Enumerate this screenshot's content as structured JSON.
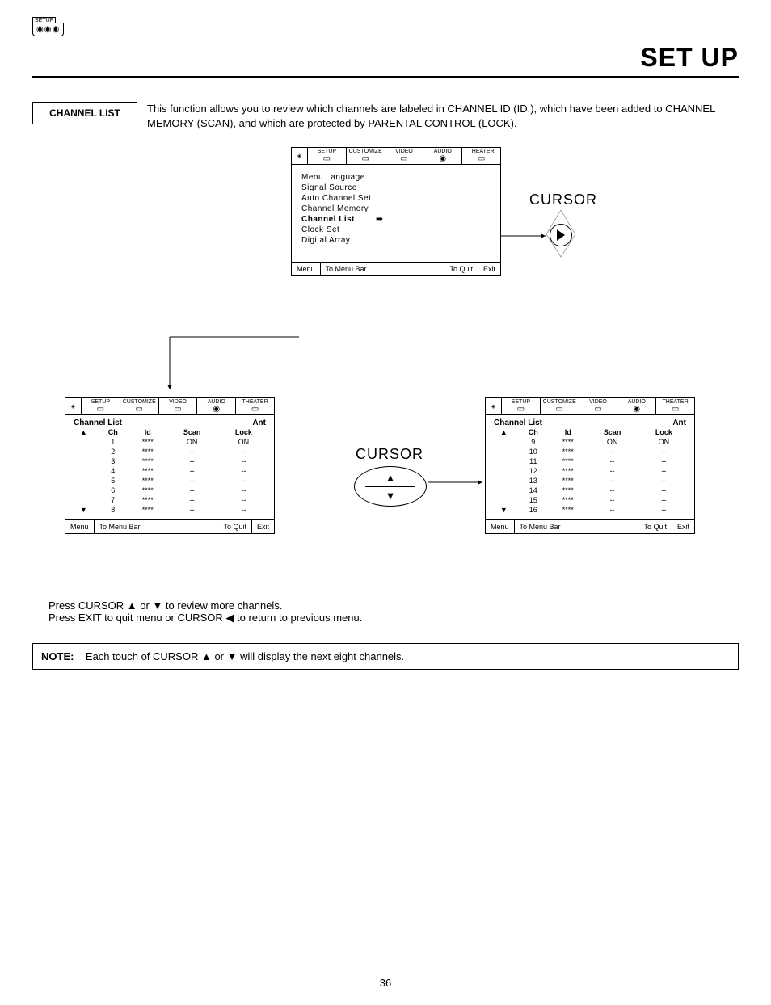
{
  "header": {
    "badge_label": "SETUP",
    "title": "SET UP"
  },
  "section": {
    "label": "CHANNEL LIST",
    "text": "This function allows you to review which channels are labeled in CHANNEL ID (ID.), which have been added to CHANNEL MEMORY (SCAN), and which are protected by PARENTAL CONTROL (LOCK)."
  },
  "osd_tabs": [
    "SETUP",
    "CUSTOMIZE",
    "VIDEO",
    "AUDIO",
    "THEATER"
  ],
  "osd_main": {
    "items": [
      "Menu Language",
      "Signal Source",
      "Auto Channel Set",
      "Channel Memory",
      "Channel List",
      "Clock Set",
      "Digital Array"
    ],
    "selected_index": 4,
    "foot_menu": "Menu",
    "foot_mid": "To Menu Bar",
    "foot_quit": "To Quit",
    "foot_exit": "Exit"
  },
  "cursor_label": "CURSOR",
  "left_list": {
    "title": "Channel List",
    "source": "Ant",
    "cols": [
      "Ch",
      "Id",
      "Scan",
      "Lock"
    ],
    "rows": [
      {
        "ch": "1",
        "id": "****",
        "scan": "ON",
        "lock": "ON"
      },
      {
        "ch": "2",
        "id": "****",
        "scan": "--",
        "lock": "--"
      },
      {
        "ch": "3",
        "id": "****",
        "scan": "--",
        "lock": "--"
      },
      {
        "ch": "4",
        "id": "****",
        "scan": "--",
        "lock": "--"
      },
      {
        "ch": "5",
        "id": "****",
        "scan": "--",
        "lock": "--"
      },
      {
        "ch": "6",
        "id": "****",
        "scan": "--",
        "lock": "--"
      },
      {
        "ch": "7",
        "id": "****",
        "scan": "--",
        "lock": "--"
      },
      {
        "ch": "8",
        "id": "****",
        "scan": "--",
        "lock": "--"
      }
    ],
    "foot_menu": "Menu",
    "foot_mid": "To Menu Bar",
    "foot_quit": "To Quit",
    "foot_exit": "Exit"
  },
  "right_list": {
    "title": "Channel List",
    "source": "Ant",
    "cols": [
      "Ch",
      "Id",
      "Scan",
      "Lock"
    ],
    "rows": [
      {
        "ch": "9",
        "id": "****",
        "scan": "ON",
        "lock": "ON"
      },
      {
        "ch": "10",
        "id": "****",
        "scan": "--",
        "lock": "--"
      },
      {
        "ch": "11",
        "id": "****",
        "scan": "--",
        "lock": "--"
      },
      {
        "ch": "12",
        "id": "****",
        "scan": "--",
        "lock": "--"
      },
      {
        "ch": "13",
        "id": "****",
        "scan": "--",
        "lock": "--"
      },
      {
        "ch": "14",
        "id": "****",
        "scan": "--",
        "lock": "--"
      },
      {
        "ch": "15",
        "id": "****",
        "scan": "--",
        "lock": "--"
      },
      {
        "ch": "16",
        "id": "****",
        "scan": "--",
        "lock": "--"
      }
    ],
    "foot_menu": "Menu",
    "foot_mid": "To Menu Bar",
    "foot_quit": "To Quit",
    "foot_exit": "Exit"
  },
  "instructions": {
    "line1": "Press CURSOR ▲ or ▼ to review more channels.",
    "line2": "Press EXIT to quit menu or CURSOR ◀ to return to previous menu."
  },
  "note": {
    "label": "NOTE:",
    "text": "Each touch of CURSOR ▲ or ▼ will display the next eight channels."
  },
  "page_number": "36"
}
